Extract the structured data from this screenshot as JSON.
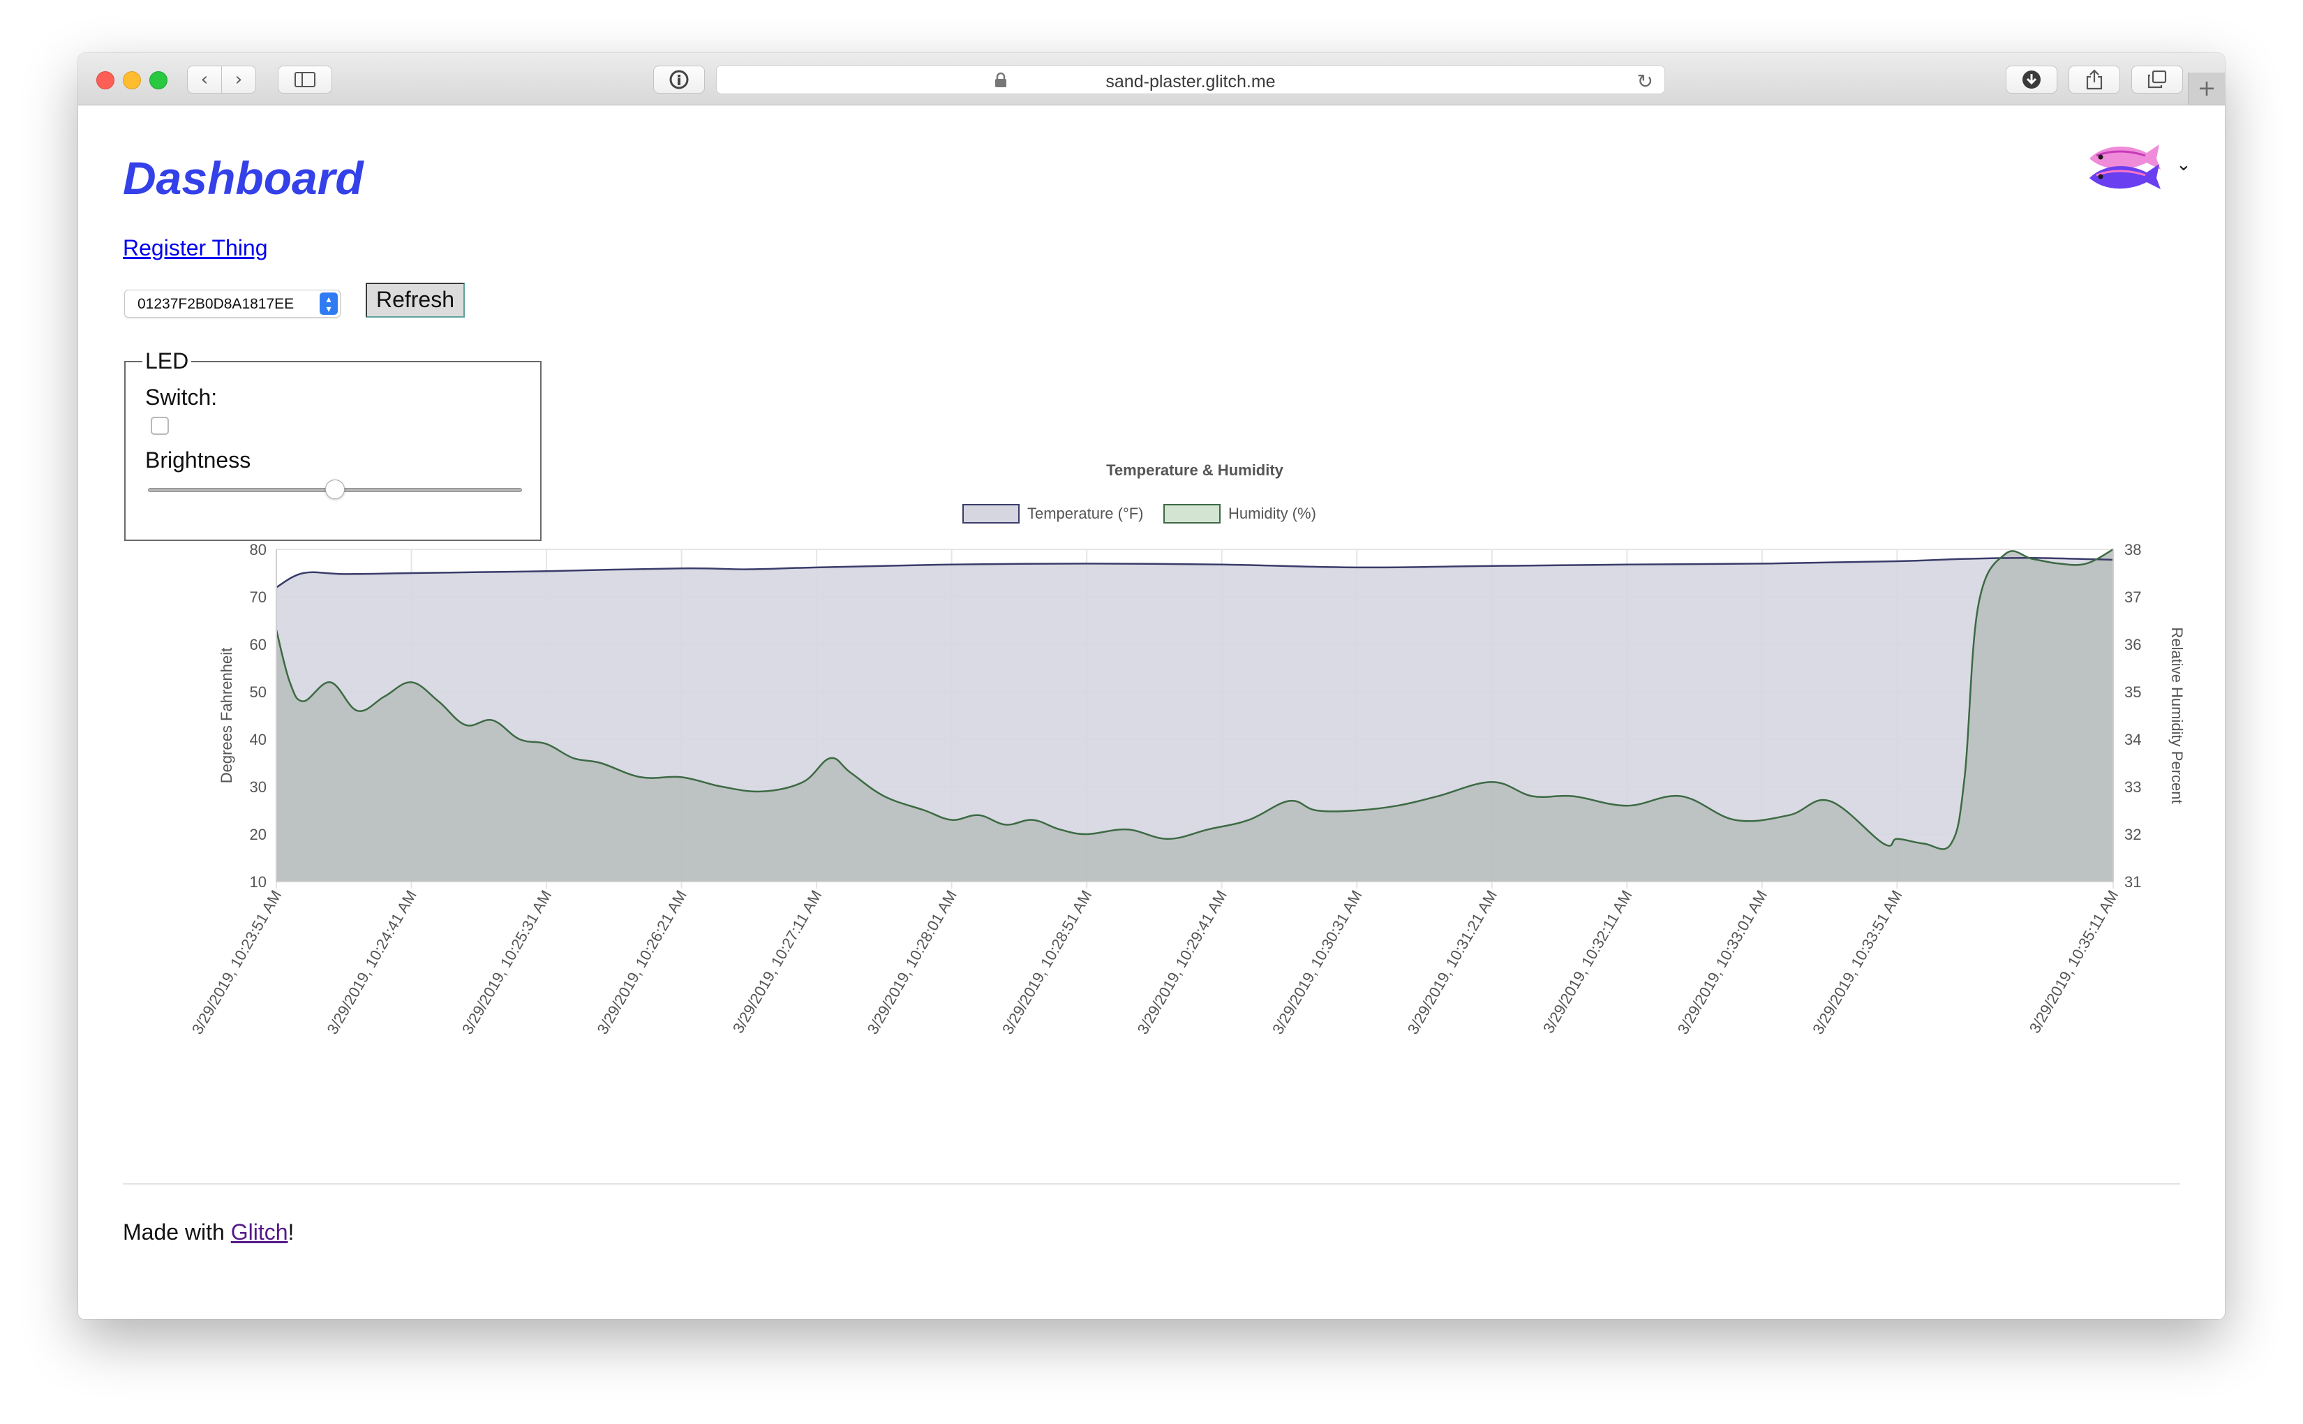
{
  "browser": {
    "url": "sand-plaster.glitch.me"
  },
  "page": {
    "title": "Dashboard",
    "register_link": "Register Thing",
    "device_select_value": "01237F2B0D8A1817EE",
    "refresh_label": "Refresh",
    "led": {
      "legend": "LED",
      "switch_label": "Switch:",
      "switch_checked": false,
      "brightness_label": "Brightness",
      "brightness_fraction": 0.5
    },
    "footer": {
      "prefix": "Made with ",
      "link": "Glitch",
      "suffix": "!"
    }
  },
  "colors": {
    "title": "#3440e8",
    "link": "#0000ee",
    "visited_link": "#551a8b",
    "temperature_line": "#3a3c6a",
    "temperature_fill": "#d5d6e0",
    "humidity_line": "#3d6a44",
    "humidity_fill": "#b7bdbc"
  },
  "chart_data": {
    "type": "area",
    "title": "Temperature & Humidity",
    "legend": [
      "Temperature (°F)",
      "Humidity (%)"
    ],
    "legend_position": "top",
    "grid": true,
    "y_left": {
      "label": "Degrees Fahrenheit",
      "min": 10,
      "max": 80,
      "ticks": [
        10,
        20,
        30,
        40,
        50,
        60,
        70,
        80
      ]
    },
    "y_right": {
      "label": "Relative Humidity Percent",
      "min": 31,
      "max": 38,
      "ticks": [
        31,
        32,
        33,
        34,
        35,
        36,
        37,
        38
      ]
    },
    "x_tick_labels": [
      "3/29/2019, 10:23:51 AM",
      "3/29/2019, 10:24:41 AM",
      "3/29/2019, 10:25:31 AM",
      "3/29/2019, 10:26:21 AM",
      "3/29/2019, 10:27:11 AM",
      "3/29/2019, 10:28:01 AM",
      "3/29/2019, 10:28:51 AM",
      "3/29/2019, 10:29:41 AM",
      "3/29/2019, 10:30:31 AM",
      "3/29/2019, 10:31:21 AM",
      "3/29/2019, 10:32:11 AM",
      "3/29/2019, 10:33:01 AM",
      "3/29/2019, 10:33:51 AM",
      "3/29/2019, 10:35:11 AM"
    ],
    "x_tick_positions": [
      0,
      1,
      2,
      3,
      4,
      5,
      6,
      7,
      8,
      9,
      10,
      11,
      12,
      13.6
    ],
    "series": [
      {
        "name": "Temperature (°F)",
        "axis": "left",
        "x": [
          0,
          0.2,
          0.5,
          1,
          1.5,
          2,
          3,
          3.5,
          4,
          5,
          6,
          7,
          8,
          9,
          10,
          11,
          12,
          12.5,
          13,
          13.6
        ],
        "y": [
          72,
          75,
          74.8,
          75,
          75.2,
          75.4,
          76,
          75.8,
          76.2,
          76.8,
          77,
          76.8,
          76.2,
          76.5,
          76.8,
          77,
          77.5,
          78,
          78.2,
          77.8
        ]
      },
      {
        "name": "Humidity (%)",
        "axis": "right",
        "x": [
          0,
          0.1,
          0.2,
          0.4,
          0.6,
          0.8,
          1,
          1.2,
          1.4,
          1.6,
          1.8,
          2,
          2.2,
          2.4,
          2.7,
          3,
          3.3,
          3.6,
          3.9,
          4.1,
          4.25,
          4.5,
          4.8,
          5,
          5.2,
          5.4,
          5.6,
          5.8,
          6,
          6.3,
          6.6,
          6.9,
          7.2,
          7.5,
          7.7,
          8,
          8.3,
          8.6,
          9,
          9.3,
          9.6,
          10,
          10.4,
          10.8,
          11.2,
          11.5,
          11.9,
          12,
          12.2,
          12.4,
          12.5,
          12.6,
          12.8,
          13,
          13.2,
          13.4,
          13.6
        ],
        "y": [
          36.3,
          35.2,
          34.8,
          35.2,
          34.6,
          34.9,
          35.2,
          34.8,
          34.3,
          34.4,
          34.0,
          33.9,
          33.6,
          33.5,
          33.2,
          33.2,
          33.0,
          32.9,
          33.1,
          33.6,
          33.3,
          32.8,
          32.5,
          32.3,
          32.4,
          32.2,
          32.3,
          32.1,
          32.0,
          32.1,
          31.9,
          32.1,
          32.3,
          32.7,
          32.5,
          32.5,
          32.6,
          32.8,
          33.1,
          32.8,
          32.8,
          32.6,
          32.8,
          32.3,
          32.4,
          32.7,
          31.8,
          31.9,
          31.8,
          31.8,
          33.2,
          36.8,
          37.9,
          37.8,
          37.7,
          37.7,
          38.0
        ]
      }
    ]
  }
}
